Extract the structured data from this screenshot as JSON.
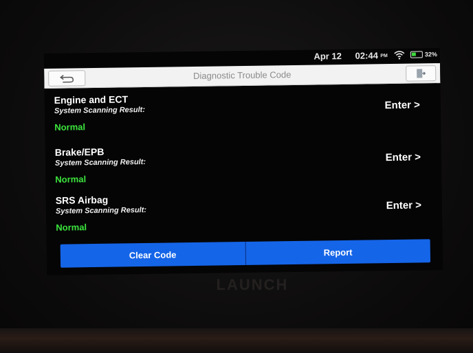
{
  "status_bar": {
    "date": "Apr 12",
    "time": "02:44",
    "ampm": "PM",
    "battery": "32%",
    "icons": [
      "wifi-icon",
      "battery-icon"
    ]
  },
  "title_bar": {
    "title": "Diagnostic Trouble Code",
    "back_icon": "back-arrow-icon",
    "exit_icon": "exit-door-icon"
  },
  "systems": [
    {
      "name": "Engine and ECT",
      "scan_label": "System Scanning Result:",
      "result": "Normal",
      "action": "Enter >"
    },
    {
      "name": "Brake/EPB",
      "scan_label": "System Scanning Result:",
      "result": "Normal",
      "action": "Enter >"
    },
    {
      "name": "SRS Airbag",
      "scan_label": "System Scanning Result:",
      "result": "Normal",
      "action": "Enter >"
    }
  ],
  "bottom_bar": {
    "clear_code": "Clear Code",
    "report": "Report"
  },
  "device": {
    "brand": "LAUNCH"
  },
  "colors": {
    "accent": "#1565e8",
    "result_ok": "#3ce53c",
    "title_bg": "#f2f2f2"
  }
}
